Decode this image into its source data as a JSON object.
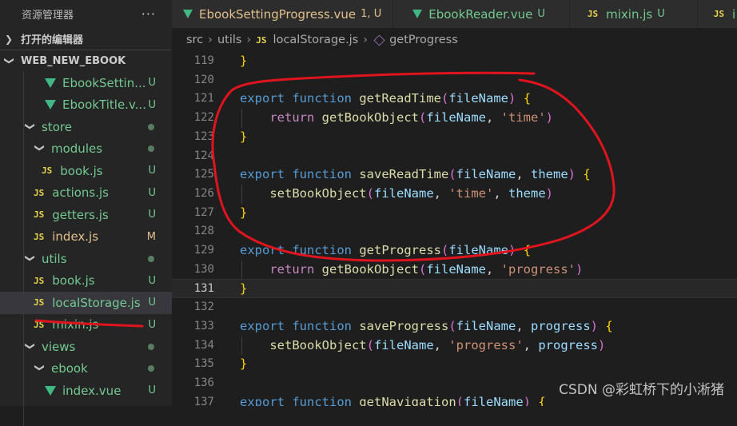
{
  "sidebar": {
    "title": "资源管理器",
    "more": "···",
    "open_editors": "打开的编辑器",
    "project": "WEB_NEW_EBOOK",
    "items": [
      {
        "label": "EbookSettin...",
        "type": "vue",
        "status": "U"
      },
      {
        "label": "EbookTitle.v...",
        "type": "vue",
        "status": "U"
      },
      {
        "label": "store",
        "type": "folder",
        "status": "•"
      },
      {
        "label": "modules",
        "type": "folder",
        "status": "•"
      },
      {
        "label": "book.js",
        "type": "js",
        "status": "U"
      },
      {
        "label": "actions.js",
        "type": "js",
        "status": "U"
      },
      {
        "label": "getters.js",
        "type": "js",
        "status": "U"
      },
      {
        "label": "index.js",
        "type": "js",
        "status": "M"
      },
      {
        "label": "utils",
        "type": "folder",
        "status": "•"
      },
      {
        "label": "book.js",
        "type": "js",
        "status": "U"
      },
      {
        "label": "localStorage.js",
        "type": "js",
        "status": "U"
      },
      {
        "label": "mixin.js",
        "type": "js",
        "status": "U"
      },
      {
        "label": "views",
        "type": "folder",
        "status": "•"
      },
      {
        "label": "ebook",
        "type": "folder",
        "status": "•"
      },
      {
        "label": "index.vue",
        "type": "vue",
        "status": "U"
      }
    ]
  },
  "tabs": [
    {
      "label": "EbookSettingProgress.vue",
      "status": "1, U"
    },
    {
      "label": "EbookReader.vue",
      "status": "U"
    },
    {
      "label": "mixin.js",
      "status": "U"
    },
    {
      "label": "i",
      "status": ""
    }
  ],
  "breadcrumb": {
    "src": "src",
    "utils": "utils",
    "file": "localStorage.js",
    "symbol": "getProgress"
  },
  "lines": [
    {
      "n": "119",
      "text": "}"
    },
    {
      "n": "120",
      "text": ""
    },
    {
      "n": "121",
      "text": "export function getReadTime(fileName) {"
    },
    {
      "n": "122",
      "text": "    return getBookObject(fileName, 'time')"
    },
    {
      "n": "123",
      "text": "}"
    },
    {
      "n": "124",
      "text": ""
    },
    {
      "n": "125",
      "text": "export function saveReadTime(fileName, theme) {"
    },
    {
      "n": "126",
      "text": "    setBookObject(fileName, 'time', theme)"
    },
    {
      "n": "127",
      "text": "}"
    },
    {
      "n": "128",
      "text": ""
    },
    {
      "n": "129",
      "text": "export function getProgress(fileName) {"
    },
    {
      "n": "130",
      "text": "    return getBookObject(fileName, 'progress')"
    },
    {
      "n": "131",
      "text": "}"
    },
    {
      "n": "132",
      "text": ""
    },
    {
      "n": "133",
      "text": "export function saveProgress(fileName, progress) {"
    },
    {
      "n": "134",
      "text": "    setBookObject(fileName, 'progress', progress)"
    },
    {
      "n": "135",
      "text": "}"
    },
    {
      "n": "136",
      "text": ""
    },
    {
      "n": "137",
      "text": "export function getNavigation(fileName) {"
    }
  ],
  "watermark": "CSDN @彩虹桥下的小淅猪",
  "colors": {
    "annotation": "#e0141e",
    "accent_untracked": "#73c991",
    "accent_modified": "#e2c08d"
  }
}
